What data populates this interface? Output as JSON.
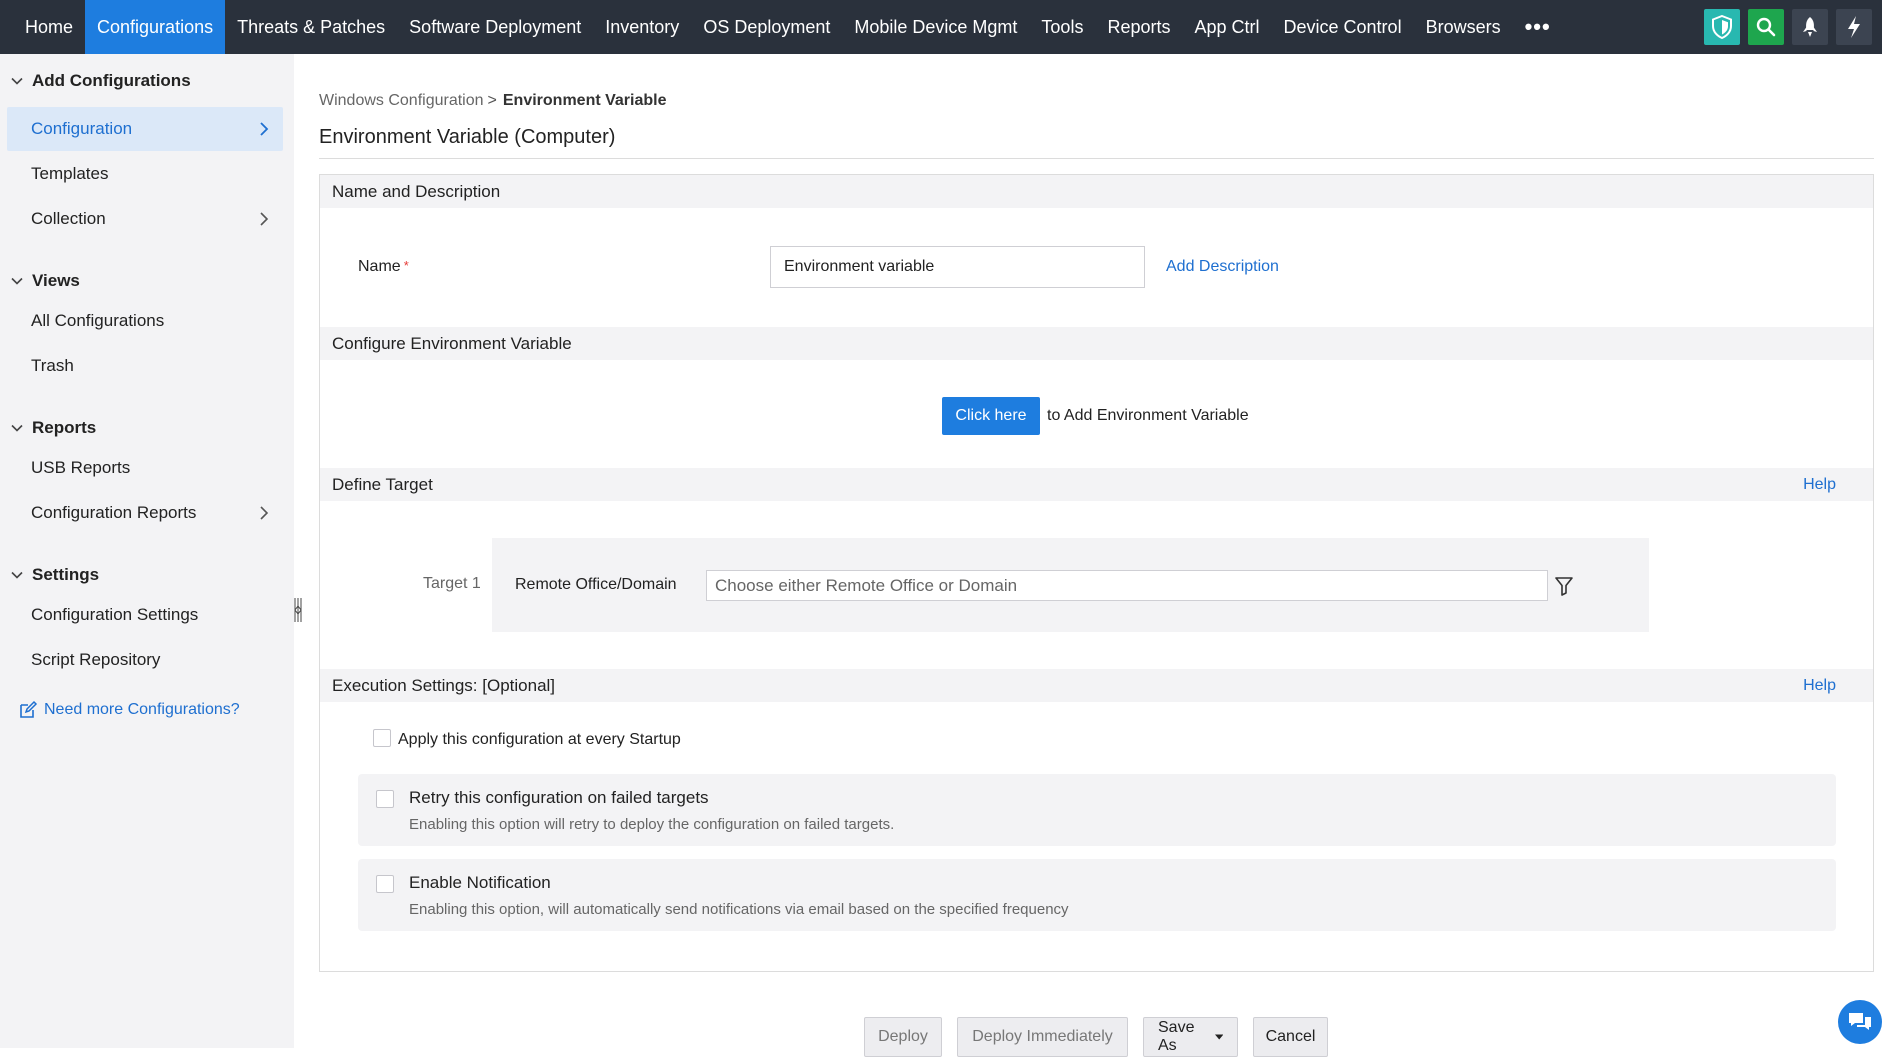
{
  "topnav": {
    "items": [
      {
        "label": "Home"
      },
      {
        "label": "Configurations"
      },
      {
        "label": "Threats & Patches"
      },
      {
        "label": "Software Deployment"
      },
      {
        "label": "Inventory"
      },
      {
        "label": "OS Deployment"
      },
      {
        "label": "Mobile Device Mgmt"
      },
      {
        "label": "Tools"
      },
      {
        "label": "Reports"
      },
      {
        "label": "App Ctrl"
      },
      {
        "label": "Device Control"
      },
      {
        "label": "Browsers"
      }
    ],
    "more_label": "•••",
    "tools": [
      "shield-icon",
      "search-icon",
      "rocket-icon",
      "lightning-icon"
    ],
    "accent": "#1e7ddf",
    "background": "#2a313c"
  },
  "sidebar": {
    "add_configurations": {
      "title": "Add Configurations",
      "items": [
        {
          "label": "Configuration"
        },
        {
          "label": "Templates"
        },
        {
          "label": "Collection"
        }
      ]
    },
    "views": {
      "title": "Views",
      "items": [
        {
          "label": "All Configurations"
        },
        {
          "label": "Trash"
        }
      ]
    },
    "reports": {
      "title": "Reports",
      "items": [
        {
          "label": "USB Reports"
        },
        {
          "label": "Configuration Reports"
        }
      ]
    },
    "settings": {
      "title": "Settings",
      "items": [
        {
          "label": "Configuration Settings"
        },
        {
          "label": "Script Repository"
        }
      ]
    },
    "need_more_link": "Need more Configurations?"
  },
  "main": {
    "breadcrumb": {
      "parent": "Windows Configuration",
      "separator": ">",
      "current": "Environment Variable"
    },
    "title": "Environment Variable (Computer)",
    "name_section": {
      "heading": "Name and Description",
      "name_label": "Name",
      "required_mark": "*",
      "name_value": "Environment variable",
      "add_description": "Add Description"
    },
    "configure_section": {
      "heading": "Configure Environment Variable",
      "click_here": "Click here",
      "suffix": "to Add Environment Variable"
    },
    "target_section": {
      "heading": "Define Target",
      "help": "Help",
      "target_label": "Target 1",
      "type_label": "Remote Office/Domain",
      "placeholder": "Choose either Remote Office or Domain"
    },
    "execution_section": {
      "heading": "Execution Settings: [Optional]",
      "help": "Help",
      "startup_label": "Apply this configuration at every Startup",
      "retry_title": "Retry this configuration on failed targets",
      "retry_desc": "Enabling this option will retry to deploy the configuration on failed targets.",
      "notify_title": "Enable Notification",
      "notify_desc": "Enabling this option, will automatically send notifications via email based on the specified frequency"
    }
  },
  "footer_buttons": {
    "deploy": "Deploy",
    "deploy_immediately": "Deploy Immediately",
    "save_as": "Save As",
    "cancel": "Cancel"
  }
}
